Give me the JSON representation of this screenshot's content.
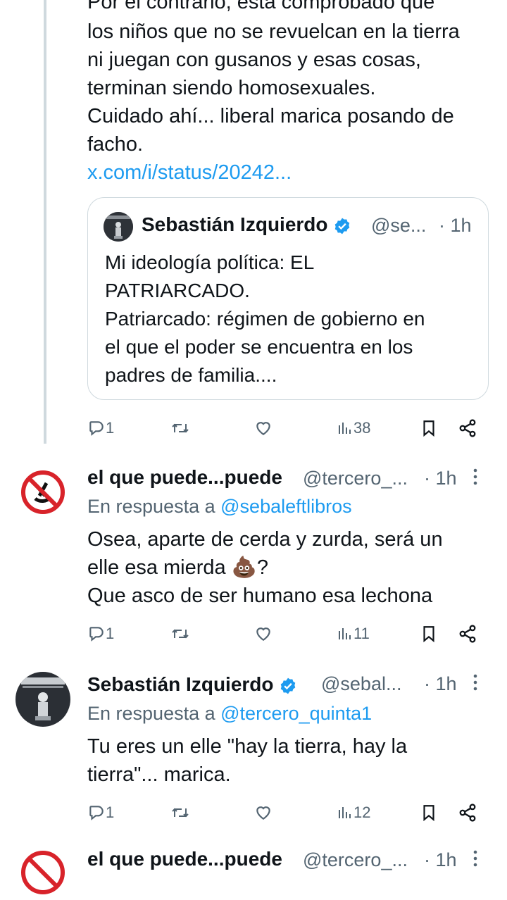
{
  "tweet1": {
    "text_lines": [
      "Por el contrario, está comprobado que",
      "los niños que no se revuelcan en la tierra",
      "ni juegan con gusanos y esas cosas,",
      "terminan siendo homosexuales.",
      "Cuidado ahí... liberal marica posando de",
      "facho."
    ],
    "link": "x.com/i/status/20242...",
    "quote": {
      "name": "Sebastián Izquierdo",
      "handle": "@se...",
      "time": "· 1h",
      "text": "Mi ideología política: EL\nPATRIARCADO.\nPatriarcado: régimen de gobierno en\nel que el poder se encuentra en los\npadres de familia...."
    },
    "actions": {
      "replies": "1",
      "views": "38"
    }
  },
  "tweet2": {
    "name": "el que puede...puede",
    "handle": "@tercero_...",
    "time": "· 1h",
    "reply_prefix": "En respuesta a",
    "reply_to": "@sebaleftlibros",
    "text": "Osea, aparte de cerda y zurda, será un\nelle esa mierda 💩?\nQue asco de ser humano esa lechona",
    "actions": {
      "replies": "1",
      "views": "11"
    }
  },
  "tweet3": {
    "name": "Sebastián Izquierdo",
    "handle": "@sebal...",
    "time": "· 1h",
    "reply_prefix": "En respuesta a",
    "reply_to": "@tercero_quinta1",
    "text": "Tu eres un elle \"hay la tierra, hay la\ntierra\"... marica.",
    "actions": {
      "replies": "1",
      "views": "12"
    }
  },
  "tweet4": {
    "name": "el que puede...puede",
    "handle": "@tercero_...",
    "time": "· 1h"
  },
  "icons": {
    "reply": "reply-icon",
    "retweet": "retweet-icon",
    "like": "heart-icon",
    "views": "views-icon",
    "bookmark": "bookmark-icon",
    "share": "share-icon",
    "more": "more-vertical-icon",
    "verified": "verified-badge-icon"
  },
  "colors": {
    "link": "#1d9bf0",
    "muted": "#536471",
    "verified": "#1d9bf0",
    "text": "#0f1419"
  }
}
